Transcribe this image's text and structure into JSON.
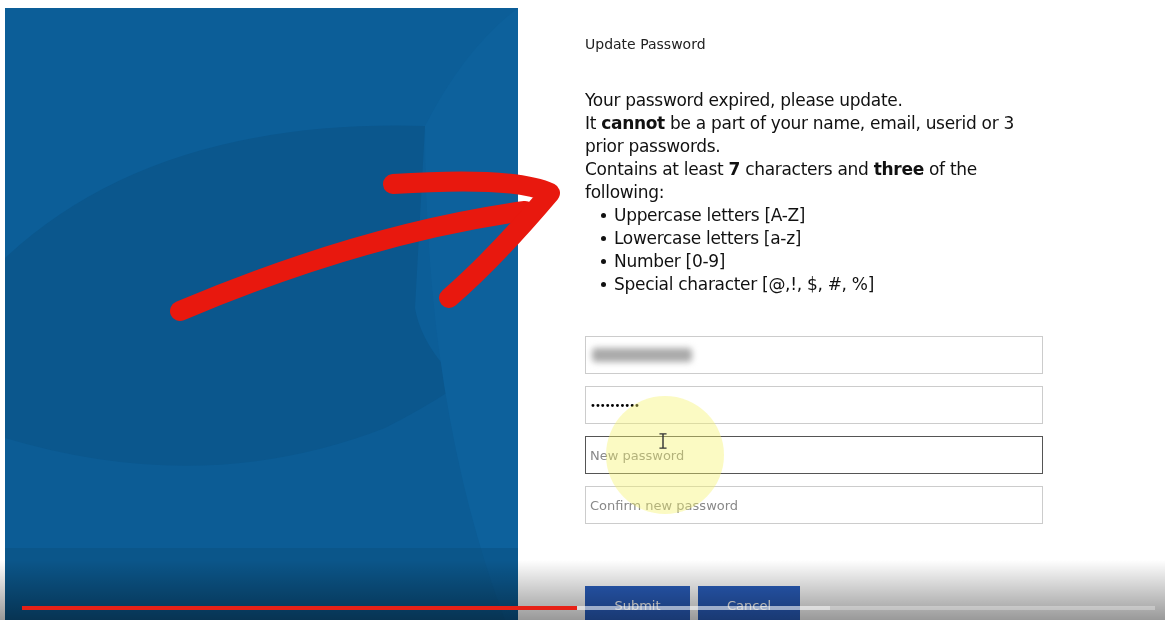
{
  "form": {
    "title": "Update Password",
    "paragraphs": [
      "Your password expired, please update.",
      "It **cannot** be a part of your name, email, userid or 3 prior passwords.",
      "Contains at least **7** characters and **three** of the following:"
    ],
    "rules": [
      "Uppercase letters [A-Z]",
      "Lowercase letters [a-z]",
      "Number [0-9]",
      "Special character [@,!, $, #, %]"
    ],
    "fields": [
      {
        "kind": "blurred",
        "focused": false
      },
      {
        "kind": "password",
        "value": "••••••••••",
        "focused": false
      },
      {
        "kind": "input",
        "placeholder": "New password",
        "focused": true
      },
      {
        "kind": "input",
        "placeholder": "Confirm new password",
        "focused": false
      }
    ],
    "buttons": [
      "Submit",
      "Cancel"
    ]
  },
  "video_player": {
    "progress": {
      "level": 0.49
    }
  }
}
